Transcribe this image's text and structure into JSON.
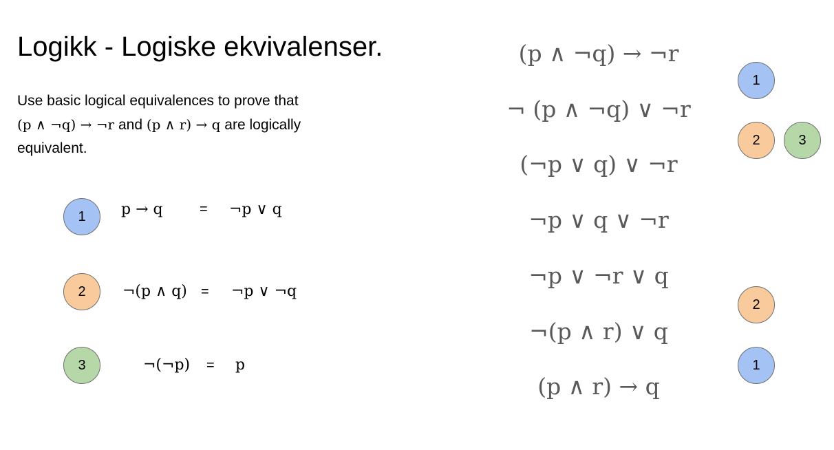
{
  "title": "Logikk - Logiske ekvivalenser.",
  "task": {
    "line1": "Use basic logical equivalences to prove that",
    "expr_a": "(p ∧ ¬q) → ¬r",
    "and_word": " and ",
    "expr_b": "(p ∧ r) → q",
    "tail": " are logically",
    "line3": "equivalent."
  },
  "rules": [
    {
      "number": "1",
      "color": "#a4c2f4",
      "lhs": "p → q",
      "eq": "=",
      "rhs": "¬p ∨ q"
    },
    {
      "number": "2",
      "color": "#f9cb9c",
      "lhs": "¬(p ∧ q)",
      "eq": "=",
      "rhs": "¬p ∨ ¬q"
    },
    {
      "number": "3",
      "color": "#b6d7a8",
      "lhs": "¬(¬p)",
      "eq": "=",
      "rhs": "p"
    }
  ],
  "proof_steps": [
    "(p ∧ ¬q) → ¬r",
    "¬ (p ∧ ¬q) ∨ ¬r",
    "(¬p ∨ q) ∨ ¬r",
    "¬p ∨ q ∨ ¬r",
    "¬p ∨ ¬r ∨ q",
    "¬(p ∧ r) ∨ q",
    "(p ∧ r) → q"
  ],
  "step_markers": [
    {
      "label": "1",
      "color": "#a4c2f4"
    },
    {
      "label": "2",
      "color": "#f9cb9c"
    },
    {
      "label": "3",
      "color": "#b6d7a8"
    },
    {
      "label": "2",
      "color": "#f9cb9c"
    },
    {
      "label": "1",
      "color": "#a4c2f4"
    }
  ]
}
